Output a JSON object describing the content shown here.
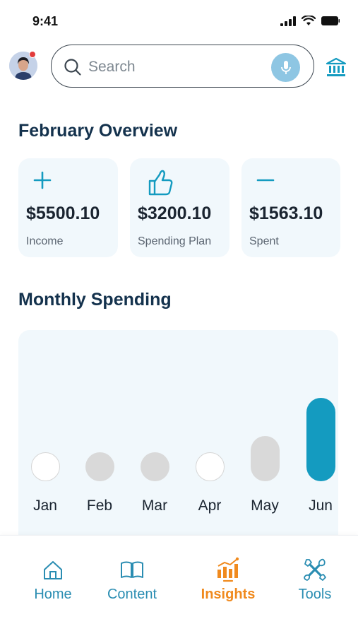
{
  "status_bar": {
    "time": "9:41"
  },
  "header": {
    "search_placeholder": "Search"
  },
  "overview": {
    "title": "February Overview",
    "cards": [
      {
        "icon": "plus-icon",
        "amount": "$5500.10",
        "label": "Income"
      },
      {
        "icon": "thumbs-up-icon",
        "amount": "$3200.10",
        "label": "Spending Plan"
      },
      {
        "icon": "minus-icon",
        "amount": "$1563.10",
        "label": "Spent"
      }
    ]
  },
  "monthly_spending": {
    "title": "Monthly Spending",
    "months": [
      {
        "label": "Jan",
        "state": "empty"
      },
      {
        "label": "Feb",
        "state": "filled"
      },
      {
        "label": "Mar",
        "state": "filled"
      },
      {
        "label": "Apr",
        "state": "empty"
      },
      {
        "label": "May",
        "state": "filled"
      },
      {
        "label": "Jun",
        "state": "active"
      }
    ]
  },
  "bottom_nav": {
    "items": [
      {
        "label": "Home",
        "icon": "home-icon",
        "active": false
      },
      {
        "label": "Content",
        "icon": "book-icon",
        "active": false
      },
      {
        "label": "Insights",
        "icon": "bar-chart-icon",
        "active": true
      },
      {
        "label": "Tools",
        "icon": "tools-icon",
        "active": false
      }
    ]
  },
  "colors": {
    "accent": "#149bc0",
    "active_nav": "#f08a1e",
    "title": "#14324d",
    "card_bg": "#f1f8fc"
  }
}
